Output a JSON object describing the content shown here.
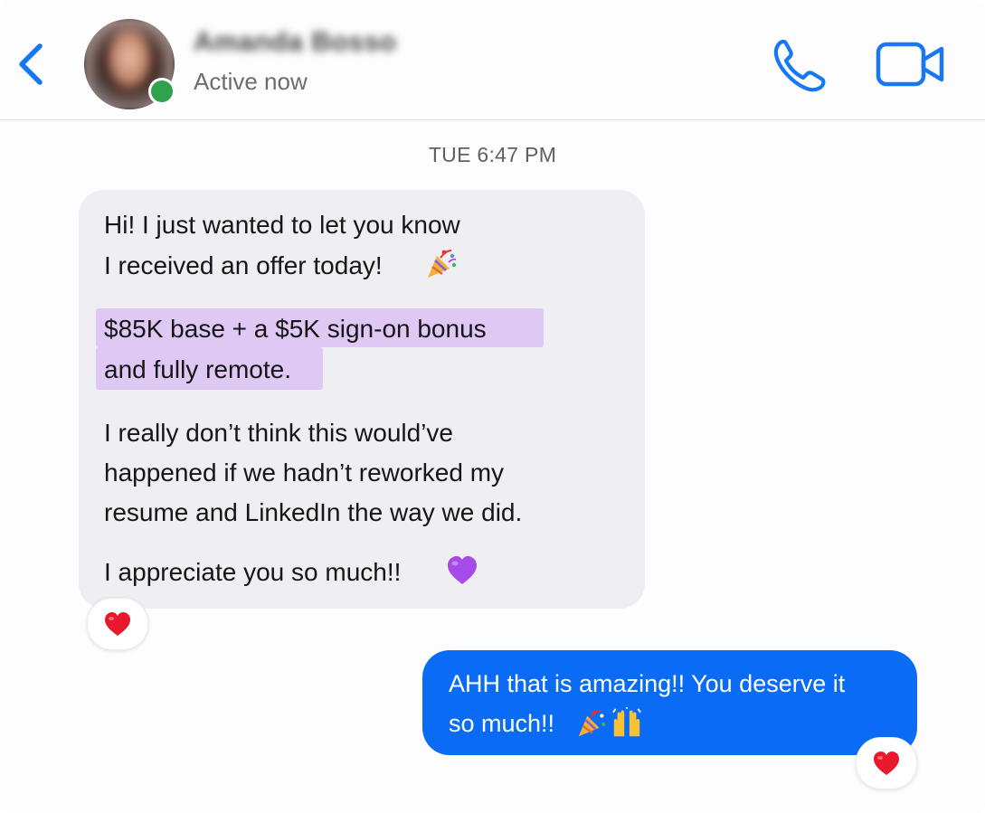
{
  "header": {
    "contact_name": "Amanda Bosso",
    "status": "Active now",
    "icons": [
      "back-icon",
      "phone-icon",
      "video-camera-icon"
    ]
  },
  "conversation": {
    "timestamp": "TUE 6:47 PM",
    "incoming": {
      "paragraph1": [
        "Hi! I just wanted to let you know",
        "I received an offer today!"
      ],
      "paragraph2_highlighted": [
        "$85K base + a $5K sign-on bonus",
        "and fully remote."
      ],
      "paragraph3": [
        "I really don’t think this would’ve",
        "happened if we hadn’t reworked my",
        "resume and LinkedIn the way we did."
      ],
      "paragraph4": "I appreciate you so much!!",
      "emojis": [
        "party-popper",
        "purple-heart"
      ],
      "reaction": "red-heart"
    },
    "outgoing": {
      "lines": [
        "AHH that is amazing!! You deserve it",
        "so much!!"
      ],
      "emojis": [
        "party-popper",
        "raising-hands"
      ],
      "reaction": "red-heart"
    }
  },
  "colors": {
    "accent_blue": "#1877f2",
    "outgoing_bubble": "#0a6cf5",
    "incoming_bubble": "#efeff3",
    "highlight": "#dfc8f4",
    "online_green": "#31a24c",
    "heart_red": "#e8192c",
    "purple_heart": "#a74be8"
  }
}
